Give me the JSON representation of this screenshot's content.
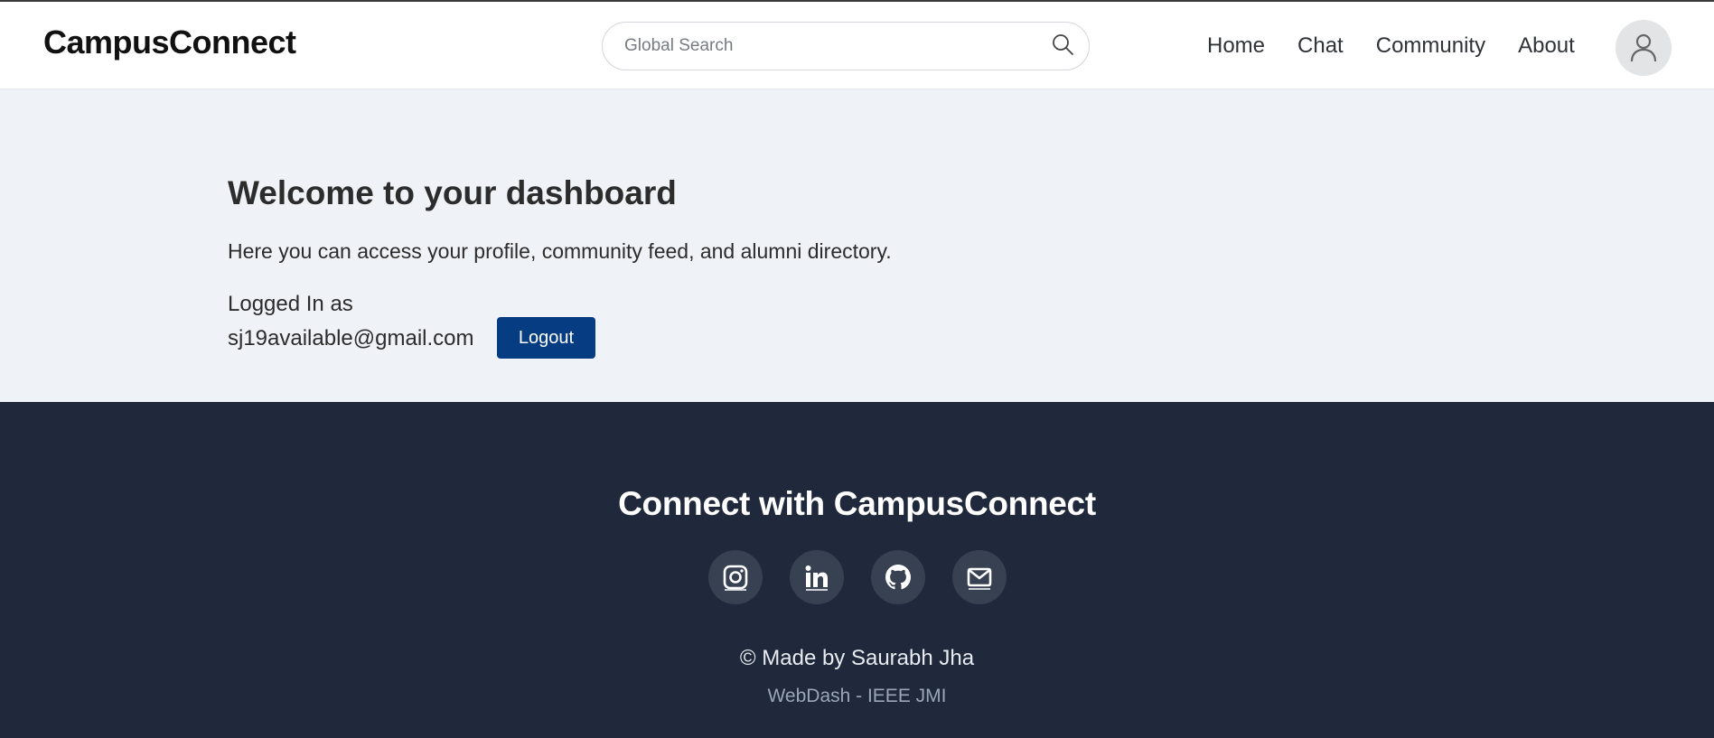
{
  "navbar": {
    "brand": "CampusConnect",
    "search": {
      "placeholder": "Global Search",
      "value": ""
    },
    "links": [
      {
        "label": "Home"
      },
      {
        "label": "Chat"
      },
      {
        "label": "Community"
      },
      {
        "label": "About"
      }
    ],
    "avatar_icon": "user-icon"
  },
  "dashboard": {
    "title": "Welcome to your dashboard",
    "subtitle": "Here you can access your profile, community feed, and alumni directory.",
    "logged_in_label": "Logged In as",
    "email": "sj19available@gmail.com",
    "logout_label": "Logout"
  },
  "footer": {
    "heading": "Connect with CampusConnect",
    "socials": [
      {
        "icon": "instagram-icon"
      },
      {
        "icon": "linkedin-icon"
      },
      {
        "icon": "github-icon"
      },
      {
        "icon": "mail-icon"
      }
    ],
    "credit": "© Made by Saurabh Jha",
    "org": "WebDash - IEEE JMI"
  },
  "colors": {
    "navbar_bg": "#ffffff",
    "page_bg": "#eff2f7",
    "footer_bg": "#1f293b",
    "logout_button": "#063c82",
    "social_circle": "#374152"
  }
}
